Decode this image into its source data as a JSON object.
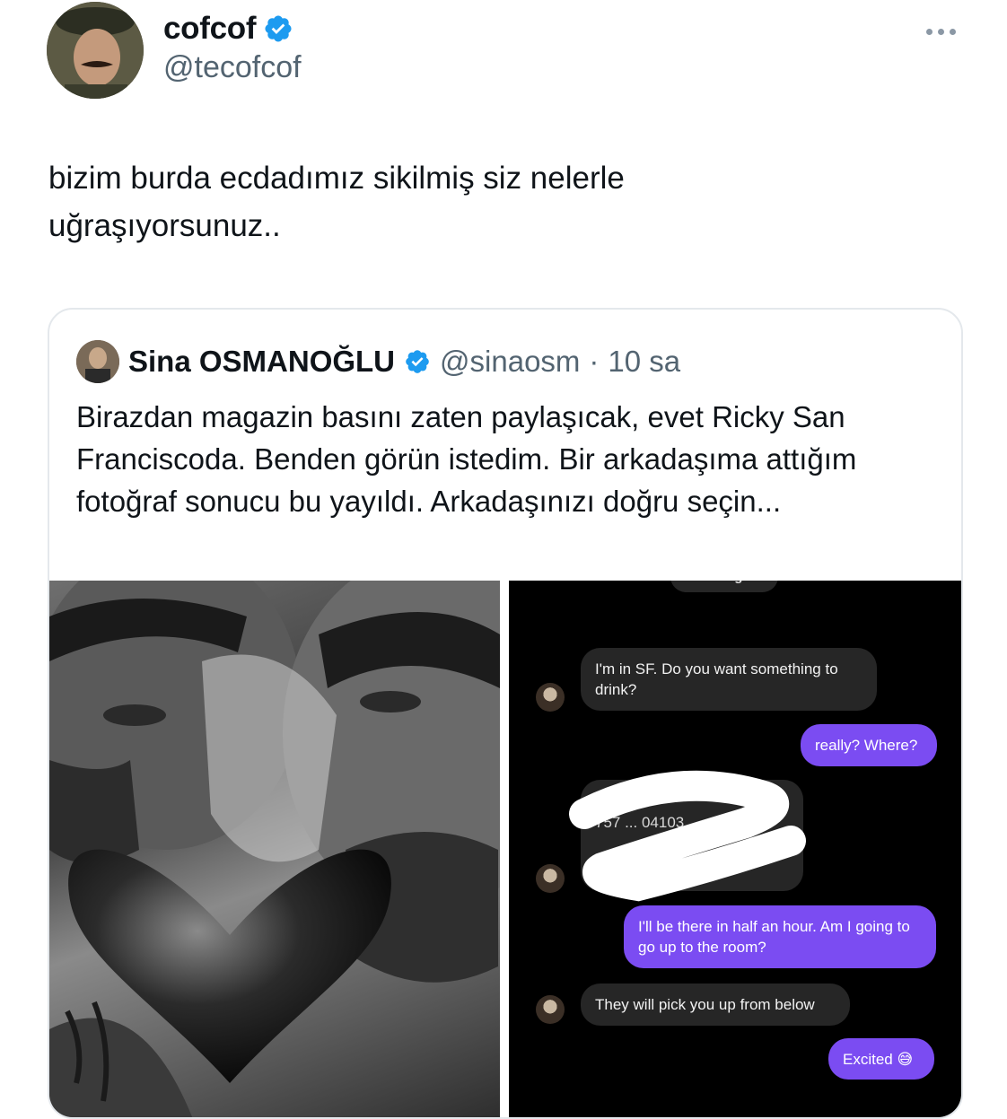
{
  "tweet": {
    "display_name": "cofcof",
    "handle": "@tecofcof",
    "text": "bizim burda ecdadımız sikilmiş siz nelerle\nuğraşıyorsunuz..",
    "avatar_icon": "user-avatar-photo",
    "verified_icon": "verified-badge-icon",
    "more_icon": "more-options-icon"
  },
  "quote": {
    "display_name": "Sina OSMANOĞLU",
    "handle": "@sinaosm",
    "separator": "·",
    "time": "10 sa",
    "text": "Birazdan magazin basını zaten paylaşıcak, evet Ricky San Franciscoda. Benden görün istedim. Bir arkadaşıma attığım fotoğraf sonucu bu yayıldı. Arkadaşınızı doğru seçin..."
  },
  "chat": {
    "top_label": "Profili gör",
    "messages": [
      {
        "side": "in",
        "text": "I'm in SF. Do you want something to drink?"
      },
      {
        "side": "out",
        "text": "really? Where?"
      },
      {
        "side": "in",
        "text": "757 ... 04103 ... easons",
        "redacted": true
      },
      {
        "side": "out",
        "text": "I'll be there in half an hour. Am I going to go up to the room?"
      },
      {
        "side": "in",
        "text": "They will pick you up from below"
      },
      {
        "side": "out",
        "text": "Excited 😅"
      }
    ]
  },
  "colors": {
    "verified": "#1d9bf0",
    "secondary_text": "#536471",
    "outgoing_bubble": "#7b4cf2",
    "incoming_bubble": "#262626"
  }
}
